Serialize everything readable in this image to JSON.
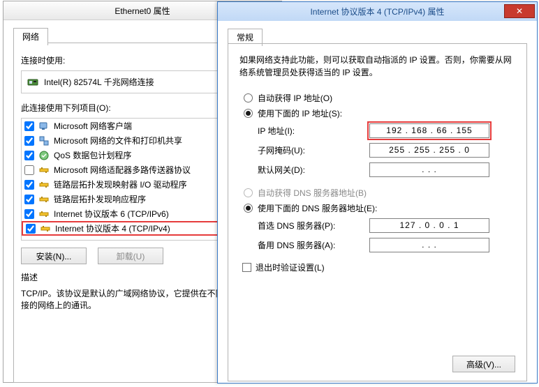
{
  "backWindow": {
    "title": "Ethernet0 属性",
    "tab": "网络",
    "connectUsingLabel": "连接时使用:",
    "adapterName": "Intel(R) 82574L 千兆网络连接",
    "componentsLabel": "此连接使用下列项目(O):",
    "items": [
      {
        "checked": true,
        "icon": "client",
        "label": "Microsoft 网络客户端"
      },
      {
        "checked": true,
        "icon": "service",
        "label": "Microsoft 网络的文件和打印机共享"
      },
      {
        "checked": true,
        "icon": "qos",
        "label": "QoS 数据包计划程序"
      },
      {
        "checked": false,
        "icon": "proto",
        "label": "Microsoft 网络适配器多路传送器协议"
      },
      {
        "checked": true,
        "icon": "proto",
        "label": "链路层拓扑发现映射器 I/O 驱动程序"
      },
      {
        "checked": true,
        "icon": "proto",
        "label": "链路层拓扑发现响应程序"
      },
      {
        "checked": true,
        "icon": "proto",
        "label": "Internet 协议版本 6 (TCP/IPv6)"
      },
      {
        "checked": true,
        "icon": "proto",
        "label": "Internet 协议版本 4 (TCP/IPv4)",
        "highlight": true
      }
    ],
    "installBtn": "安装(N)...",
    "uninstallBtn": "卸载(U)",
    "descLabel": "描述",
    "descText": "TCP/IP。该协议是默认的广域网络协议，它提供在不同的相互连接的网络上的通讯。"
  },
  "frontWindow": {
    "title": "Internet 协议版本 4 (TCP/IPv4) 属性",
    "tab": "常规",
    "intro": "如果网络支持此功能，则可以获取自动指派的 IP 设置。否则，你需要从网络系统管理员处获得适当的 IP 设置。",
    "autoIp": "自动获得 IP 地址(O)",
    "useIp": "使用下面的 IP 地址(S):",
    "ipLabel": "IP 地址(I):",
    "ipValue": "192 . 168 .  66  . 155",
    "maskLabel": "子网掩码(U):",
    "maskValue": "255 . 255 . 255 .  0",
    "gwLabel": "默认网关(D):",
    "gwValue": ".          .          .",
    "autoDns": "自动获得 DNS 服务器地址(B)",
    "useDns": "使用下面的 DNS 服务器地址(E):",
    "dns1Label": "首选 DNS 服务器(P):",
    "dns1Value": "127 .   0   .   0   .   1",
    "dns2Label": "备用 DNS 服务器(A):",
    "dns2Value": ".          .          .",
    "validateOnExit": "退出时验证设置(L)",
    "advancedBtn": "高级(V)..."
  }
}
